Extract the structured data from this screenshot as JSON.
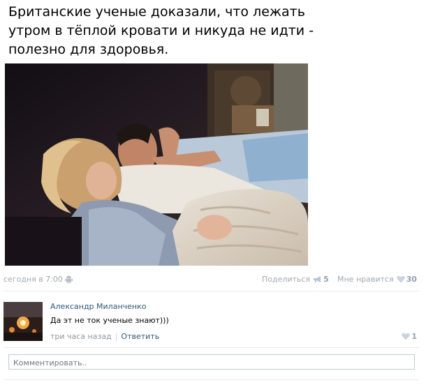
{
  "post": {
    "headline": "Британские ученые доказали, что лежать утром в тёплой кровати и никуда не идти - полезно для здоровья.",
    "image_icon": "photo-couple-in-bed",
    "timestamp": "сегодня в 7:00",
    "platform_icon": "android-icon",
    "share_label": "Поделиться",
    "share_count": "5",
    "like_label": "Мне нравится",
    "like_count": "30"
  },
  "comment": {
    "author": "Александр Миланченко",
    "text": "Да эт не ток ученые знают)))",
    "time": "три часа назад",
    "reply_label": "Ответить",
    "like_count": "1"
  },
  "comment_input": {
    "placeholder": "Комментировать.."
  },
  "colors": {
    "link": "#2b587a",
    "meta": "#a3a9b0",
    "count": "#8fa1b3",
    "border": "#c0cad5"
  }
}
